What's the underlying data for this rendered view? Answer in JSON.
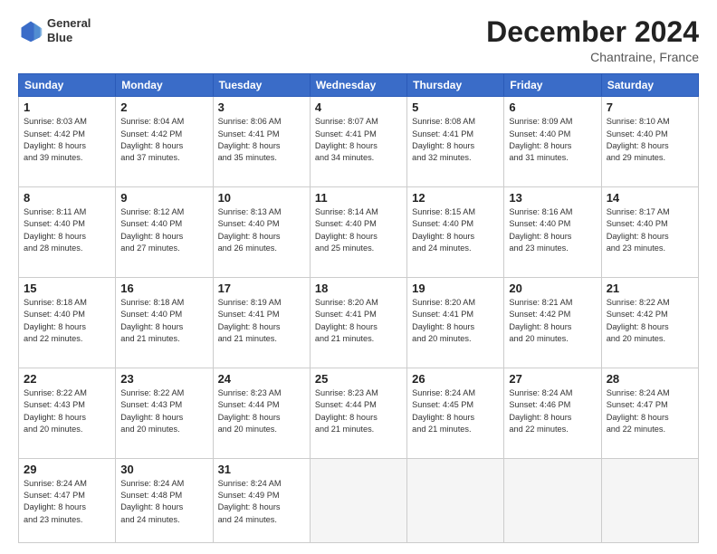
{
  "logo": {
    "line1": "General",
    "line2": "Blue"
  },
  "title": "December 2024",
  "subtitle": "Chantraine, France",
  "days_header": [
    "Sunday",
    "Monday",
    "Tuesday",
    "Wednesday",
    "Thursday",
    "Friday",
    "Saturday"
  ],
  "weeks": [
    [
      {
        "day": "1",
        "lines": [
          "Sunrise: 8:03 AM",
          "Sunset: 4:42 PM",
          "Daylight: 8 hours",
          "and 39 minutes."
        ]
      },
      {
        "day": "2",
        "lines": [
          "Sunrise: 8:04 AM",
          "Sunset: 4:42 PM",
          "Daylight: 8 hours",
          "and 37 minutes."
        ]
      },
      {
        "day": "3",
        "lines": [
          "Sunrise: 8:06 AM",
          "Sunset: 4:41 PM",
          "Daylight: 8 hours",
          "and 35 minutes."
        ]
      },
      {
        "day": "4",
        "lines": [
          "Sunrise: 8:07 AM",
          "Sunset: 4:41 PM",
          "Daylight: 8 hours",
          "and 34 minutes."
        ]
      },
      {
        "day": "5",
        "lines": [
          "Sunrise: 8:08 AM",
          "Sunset: 4:41 PM",
          "Daylight: 8 hours",
          "and 32 minutes."
        ]
      },
      {
        "day": "6",
        "lines": [
          "Sunrise: 8:09 AM",
          "Sunset: 4:40 PM",
          "Daylight: 8 hours",
          "and 31 minutes."
        ]
      },
      {
        "day": "7",
        "lines": [
          "Sunrise: 8:10 AM",
          "Sunset: 4:40 PM",
          "Daylight: 8 hours",
          "and 29 minutes."
        ]
      }
    ],
    [
      {
        "day": "8",
        "lines": [
          "Sunrise: 8:11 AM",
          "Sunset: 4:40 PM",
          "Daylight: 8 hours",
          "and 28 minutes."
        ]
      },
      {
        "day": "9",
        "lines": [
          "Sunrise: 8:12 AM",
          "Sunset: 4:40 PM",
          "Daylight: 8 hours",
          "and 27 minutes."
        ]
      },
      {
        "day": "10",
        "lines": [
          "Sunrise: 8:13 AM",
          "Sunset: 4:40 PM",
          "Daylight: 8 hours",
          "and 26 minutes."
        ]
      },
      {
        "day": "11",
        "lines": [
          "Sunrise: 8:14 AM",
          "Sunset: 4:40 PM",
          "Daylight: 8 hours",
          "and 25 minutes."
        ]
      },
      {
        "day": "12",
        "lines": [
          "Sunrise: 8:15 AM",
          "Sunset: 4:40 PM",
          "Daylight: 8 hours",
          "and 24 minutes."
        ]
      },
      {
        "day": "13",
        "lines": [
          "Sunrise: 8:16 AM",
          "Sunset: 4:40 PM",
          "Daylight: 8 hours",
          "and 23 minutes."
        ]
      },
      {
        "day": "14",
        "lines": [
          "Sunrise: 8:17 AM",
          "Sunset: 4:40 PM",
          "Daylight: 8 hours",
          "and 23 minutes."
        ]
      }
    ],
    [
      {
        "day": "15",
        "lines": [
          "Sunrise: 8:18 AM",
          "Sunset: 4:40 PM",
          "Daylight: 8 hours",
          "and 22 minutes."
        ]
      },
      {
        "day": "16",
        "lines": [
          "Sunrise: 8:18 AM",
          "Sunset: 4:40 PM",
          "Daylight: 8 hours",
          "and 21 minutes."
        ]
      },
      {
        "day": "17",
        "lines": [
          "Sunrise: 8:19 AM",
          "Sunset: 4:41 PM",
          "Daylight: 8 hours",
          "and 21 minutes."
        ]
      },
      {
        "day": "18",
        "lines": [
          "Sunrise: 8:20 AM",
          "Sunset: 4:41 PM",
          "Daylight: 8 hours",
          "and 21 minutes."
        ]
      },
      {
        "day": "19",
        "lines": [
          "Sunrise: 8:20 AM",
          "Sunset: 4:41 PM",
          "Daylight: 8 hours",
          "and 20 minutes."
        ]
      },
      {
        "day": "20",
        "lines": [
          "Sunrise: 8:21 AM",
          "Sunset: 4:42 PM",
          "Daylight: 8 hours",
          "and 20 minutes."
        ]
      },
      {
        "day": "21",
        "lines": [
          "Sunrise: 8:22 AM",
          "Sunset: 4:42 PM",
          "Daylight: 8 hours",
          "and 20 minutes."
        ]
      }
    ],
    [
      {
        "day": "22",
        "lines": [
          "Sunrise: 8:22 AM",
          "Sunset: 4:43 PM",
          "Daylight: 8 hours",
          "and 20 minutes."
        ]
      },
      {
        "day": "23",
        "lines": [
          "Sunrise: 8:22 AM",
          "Sunset: 4:43 PM",
          "Daylight: 8 hours",
          "and 20 minutes."
        ]
      },
      {
        "day": "24",
        "lines": [
          "Sunrise: 8:23 AM",
          "Sunset: 4:44 PM",
          "Daylight: 8 hours",
          "and 20 minutes."
        ]
      },
      {
        "day": "25",
        "lines": [
          "Sunrise: 8:23 AM",
          "Sunset: 4:44 PM",
          "Daylight: 8 hours",
          "and 21 minutes."
        ]
      },
      {
        "day": "26",
        "lines": [
          "Sunrise: 8:24 AM",
          "Sunset: 4:45 PM",
          "Daylight: 8 hours",
          "and 21 minutes."
        ]
      },
      {
        "day": "27",
        "lines": [
          "Sunrise: 8:24 AM",
          "Sunset: 4:46 PM",
          "Daylight: 8 hours",
          "and 22 minutes."
        ]
      },
      {
        "day": "28",
        "lines": [
          "Sunrise: 8:24 AM",
          "Sunset: 4:47 PM",
          "Daylight: 8 hours",
          "and 22 minutes."
        ]
      }
    ],
    [
      {
        "day": "29",
        "lines": [
          "Sunrise: 8:24 AM",
          "Sunset: 4:47 PM",
          "Daylight: 8 hours",
          "and 23 minutes."
        ]
      },
      {
        "day": "30",
        "lines": [
          "Sunrise: 8:24 AM",
          "Sunset: 4:48 PM",
          "Daylight: 8 hours",
          "and 24 minutes."
        ]
      },
      {
        "day": "31",
        "lines": [
          "Sunrise: 8:24 AM",
          "Sunset: 4:49 PM",
          "Daylight: 8 hours",
          "and 24 minutes."
        ]
      },
      null,
      null,
      null,
      null
    ]
  ]
}
